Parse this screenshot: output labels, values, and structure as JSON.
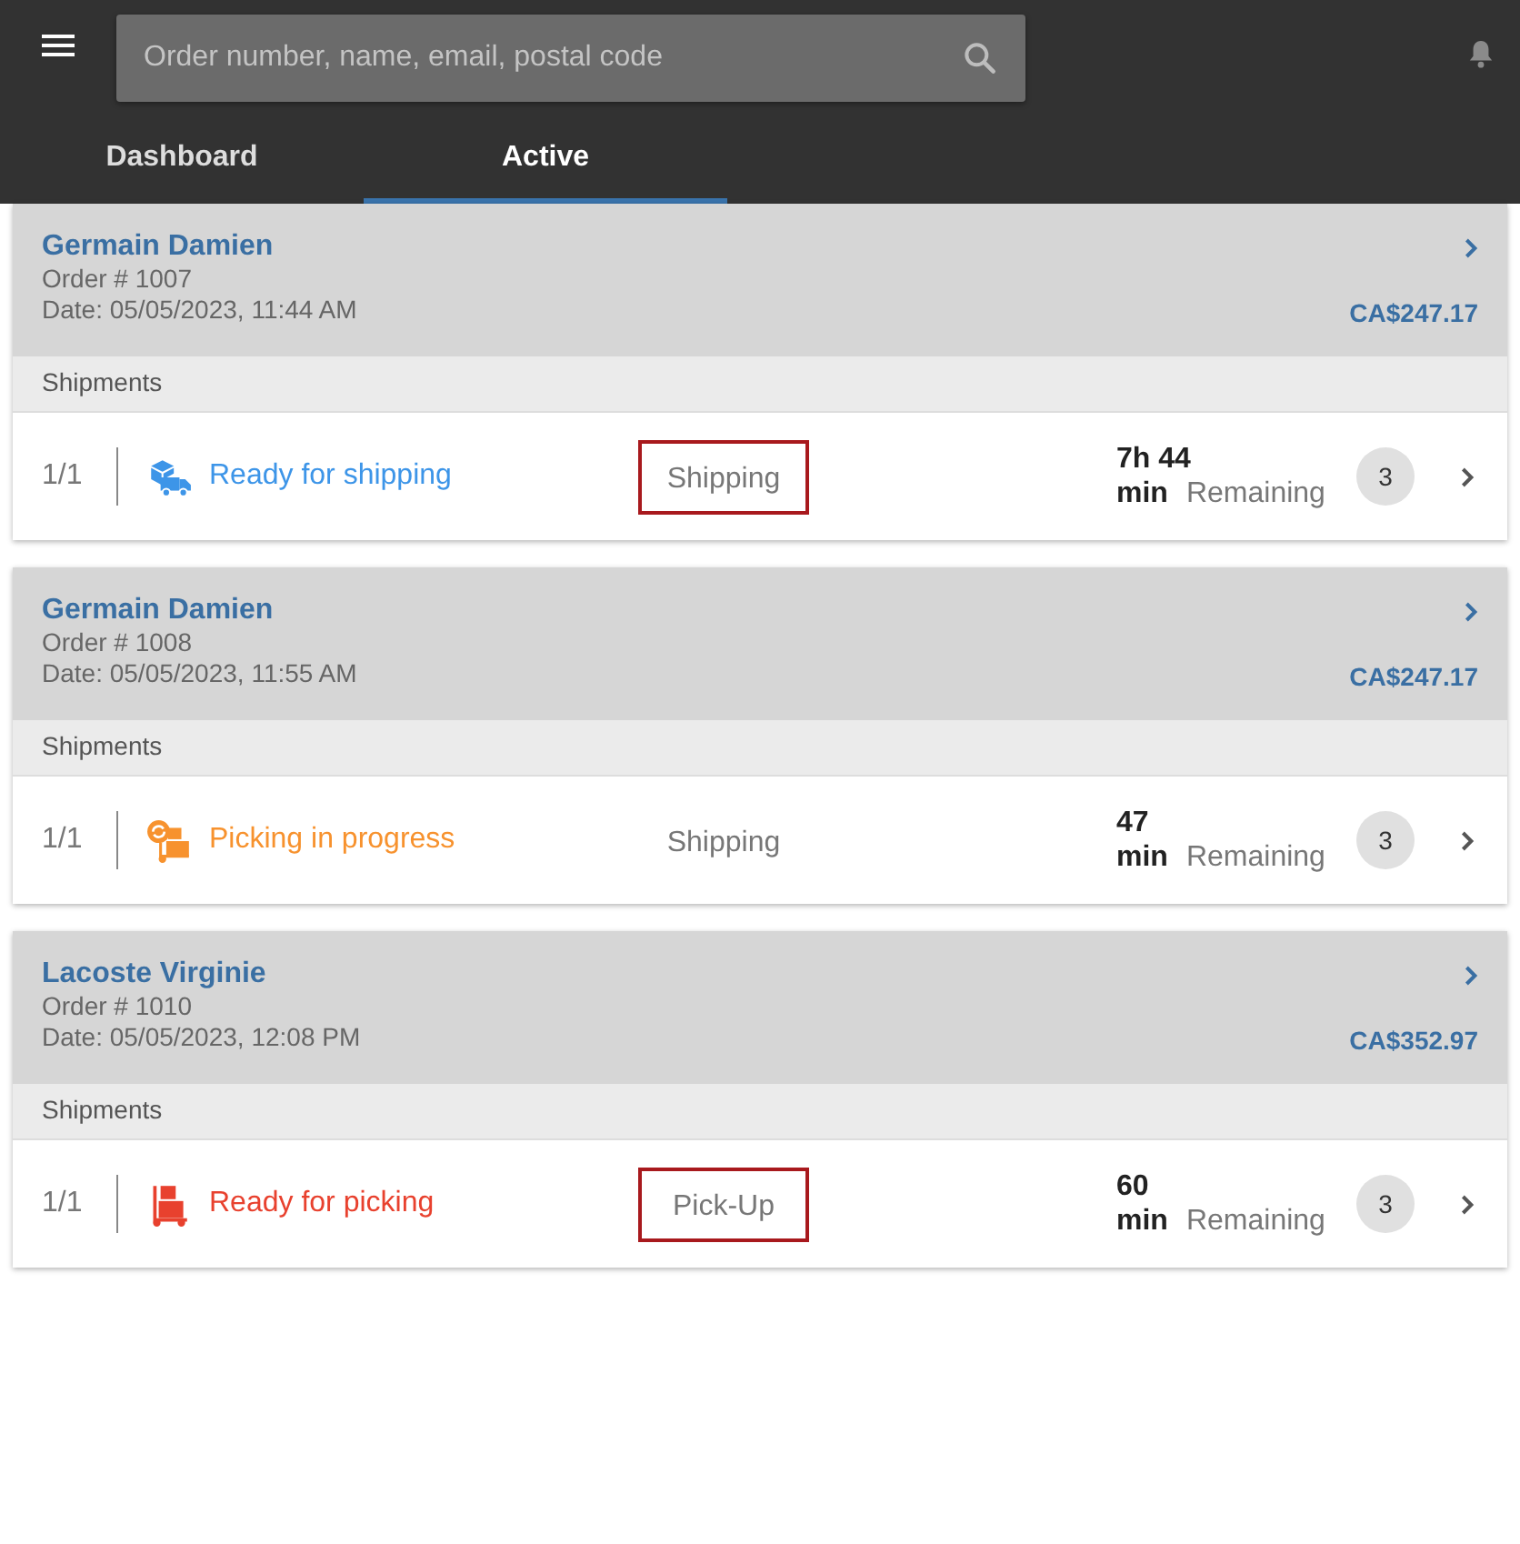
{
  "search": {
    "placeholder": "Order number, name, email, postal code"
  },
  "tabs": [
    {
      "label": "Dashboard",
      "selected": false
    },
    {
      "label": "Active",
      "selected": true
    }
  ],
  "orders": [
    {
      "customer": "Germain Damien",
      "order": "Order # 1007",
      "date": "Date: 05/05/2023, 11:44 AM",
      "total": "CA$247.17",
      "section": "Shipments",
      "shipments": [
        {
          "count": "1/1",
          "kind": "ready-shipping",
          "status": "Ready for shipping",
          "method": "Shipping",
          "highlighted": true,
          "time": "7h 44",
          "unit": "min",
          "remaining": "Remaining",
          "badge": "3"
        }
      ]
    },
    {
      "customer": "Germain Damien",
      "order": "Order # 1008",
      "date": "Date: 05/05/2023, 11:55 AM",
      "total": "CA$247.17",
      "section": "Shipments",
      "shipments": [
        {
          "count": "1/1",
          "kind": "picking-progress",
          "status": "Picking in progress",
          "method": "Shipping",
          "highlighted": false,
          "time": "47",
          "unit": "min",
          "remaining": "Remaining",
          "badge": "3"
        }
      ]
    },
    {
      "customer": "Lacoste Virginie",
      "order": "Order # 1010",
      "date": "Date: 05/05/2023, 12:08 PM",
      "total": "CA$352.97",
      "section": "Shipments",
      "shipments": [
        {
          "count": "1/1",
          "kind": "ready-picking",
          "status": "Ready for picking",
          "method": "Pick-Up",
          "highlighted": true,
          "time": "60",
          "unit": "min",
          "remaining": "Remaining",
          "badge": "3"
        }
      ]
    }
  ]
}
